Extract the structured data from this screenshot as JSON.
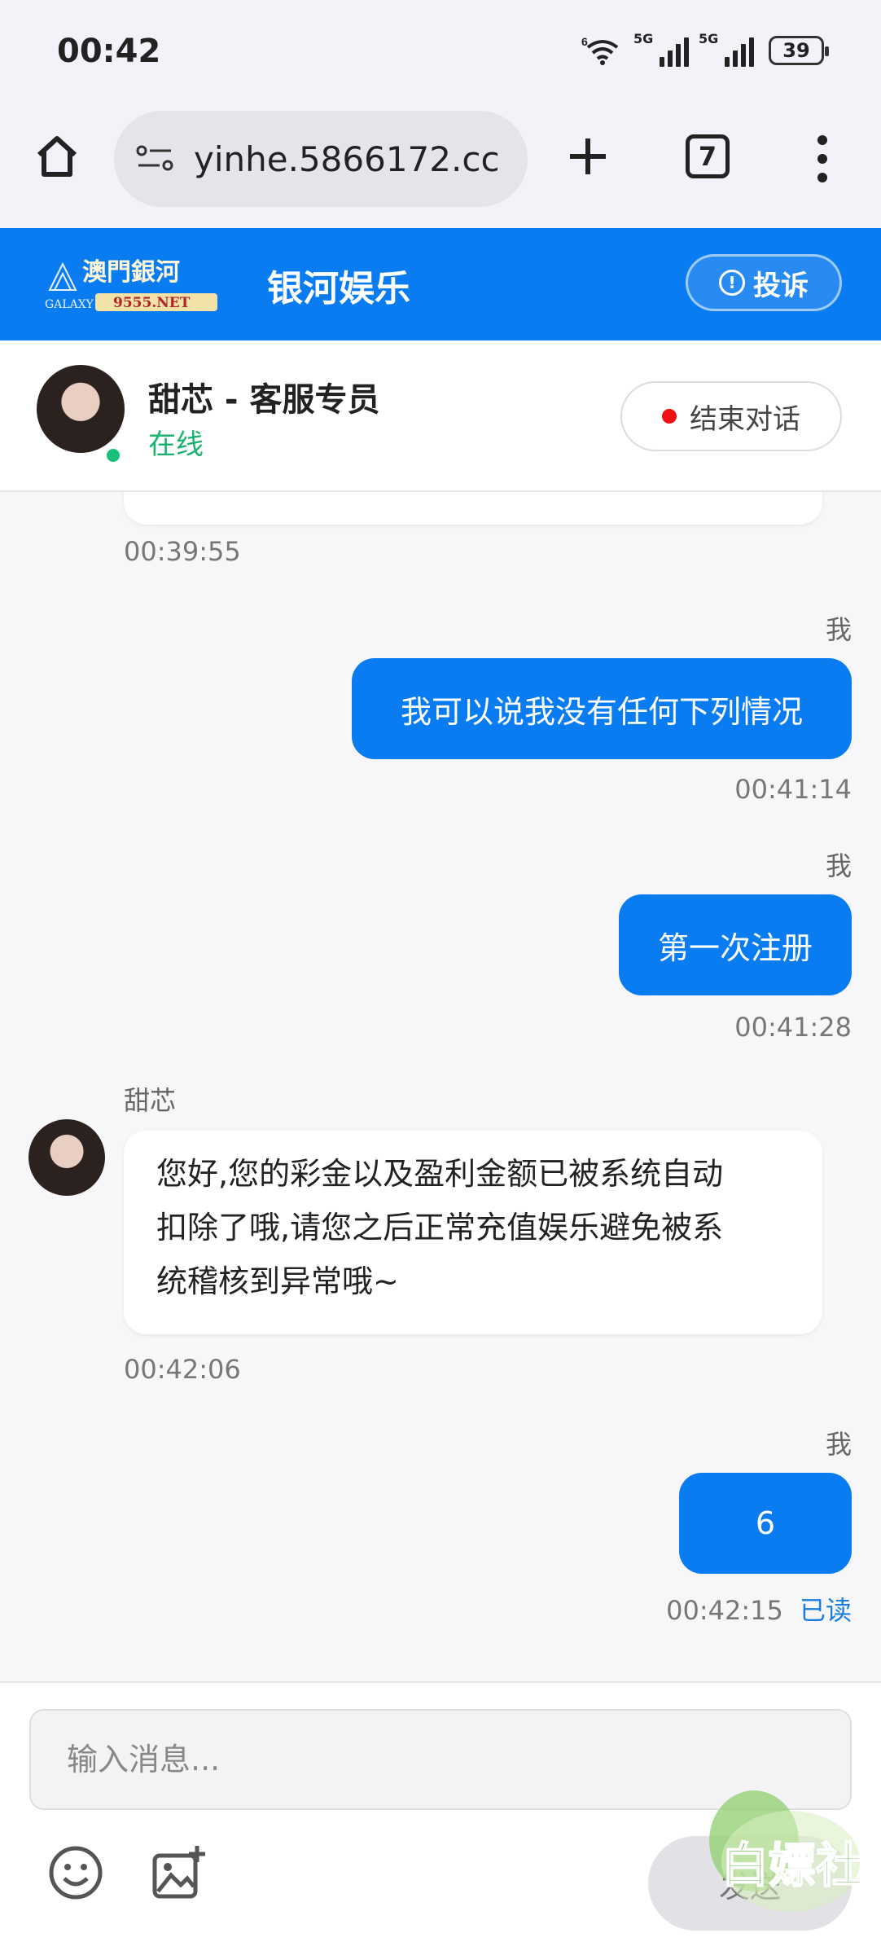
{
  "status_bar": {
    "time": "00:42",
    "wifi_tag": "6",
    "signal1_tag": "5G",
    "signal2_tag": "5G",
    "battery": "39"
  },
  "browser": {
    "url": "yinhe.5866172.cc",
    "tab_count": "7"
  },
  "header": {
    "logo_text_cn": "澳門銀河",
    "logo_text_en": "GALAXY",
    "logo_text_url": "9555.NET",
    "title": "银河娱乐",
    "complain_label": "投诉",
    "accent": "#0a7cf2"
  },
  "agent": {
    "name": "甜芯 - 客服专员",
    "status": "在线",
    "end_label": "结束对话"
  },
  "messages": [
    {
      "from": "agent",
      "time": "00:39:55"
    },
    {
      "from": "me",
      "sender": "我",
      "text": "我可以说我没有任何下列情况",
      "time": "00:41:14"
    },
    {
      "from": "me",
      "sender": "我",
      "text": "第一次注册",
      "time": "00:41:28"
    },
    {
      "from": "agent",
      "sender": "甜芯",
      "lines": [
        "您好,您的彩金以及盈利金额已被系统自动",
        "扣除了哦,请您之后正常充值娱乐避免被系",
        "统稽核到异常哦~"
      ],
      "time": "00:42:06"
    },
    {
      "from": "me",
      "sender": "我",
      "text": "6",
      "time": "00:42:15",
      "read": "已读"
    }
  ],
  "composer": {
    "placeholder": "输入消息...",
    "send_label": "发送"
  },
  "watermark_text": "白嫖社"
}
